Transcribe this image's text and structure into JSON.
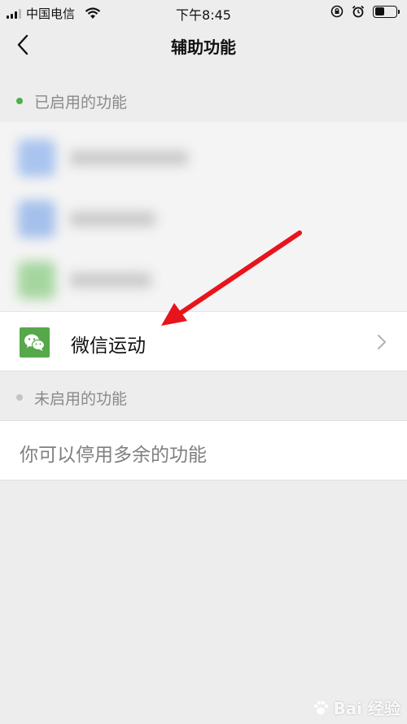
{
  "status_bar": {
    "carrier": "中国电信",
    "time": "下午8:45",
    "battery_level": 0.45
  },
  "nav": {
    "title": "辅助功能",
    "back_icon": "chevron-left-icon"
  },
  "enabled_section": {
    "header": "已启用的功能",
    "dot_color": "#4cb04c",
    "items": [
      {
        "label": "微信运动",
        "icon": "wechat-icon",
        "icon_color": "#57a74b"
      }
    ]
  },
  "disabled_section": {
    "header": "未启用的功能",
    "dot_color": "#c4c4c4",
    "empty_text": "你可以停用多余的功能"
  },
  "colors": {
    "background": "#ededed",
    "annotation_arrow": "#e8141c"
  },
  "watermark": {
    "text": "Bai 经验"
  }
}
